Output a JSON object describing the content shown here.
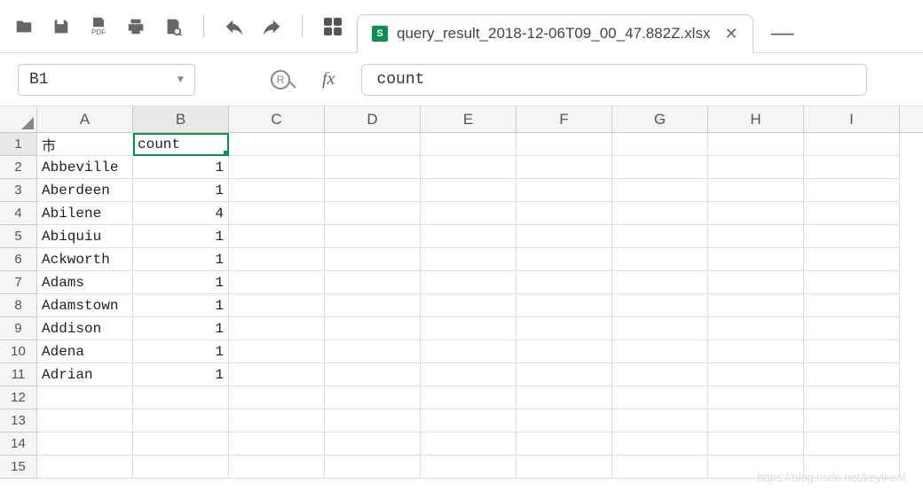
{
  "toolbar": {
    "pdf_label": "PDF"
  },
  "tab": {
    "title": "query_result_2018-12-06T09_00_47.882Z.xlsx",
    "icon_letter": "S"
  },
  "formula_bar": {
    "cell_ref": "B1",
    "r_label": "R",
    "fx_label": "fx",
    "value": "count"
  },
  "columns": [
    "A",
    "B",
    "C",
    "D",
    "E",
    "F",
    "G",
    "H",
    "I"
  ],
  "selected_cell": "B1",
  "rows": [
    {
      "n": 1,
      "A": "市",
      "B": "count"
    },
    {
      "n": 2,
      "A": "Abbeville",
      "B": "1"
    },
    {
      "n": 3,
      "A": "Aberdeen",
      "B": "1"
    },
    {
      "n": 4,
      "A": "Abilene",
      "B": "4"
    },
    {
      "n": 5,
      "A": "Abiquiu",
      "B": "1"
    },
    {
      "n": 6,
      "A": "Ackworth",
      "B": "1"
    },
    {
      "n": 7,
      "A": "Adams",
      "B": "1"
    },
    {
      "n": 8,
      "A": "Adamstown",
      "B": "1"
    },
    {
      "n": 9,
      "A": "Addison",
      "B": "1"
    },
    {
      "n": 10,
      "A": "Adena",
      "B": "1"
    },
    {
      "n": 11,
      "A": "Adrian",
      "B": "1"
    },
    {
      "n": 12,
      "A": "",
      "B": ""
    },
    {
      "n": 13,
      "A": "",
      "B": ""
    },
    {
      "n": 14,
      "A": "",
      "B": ""
    },
    {
      "n": 15,
      "A": "",
      "B": ""
    }
  ],
  "watermark": "https://blog.csdn.net/keylkeal"
}
